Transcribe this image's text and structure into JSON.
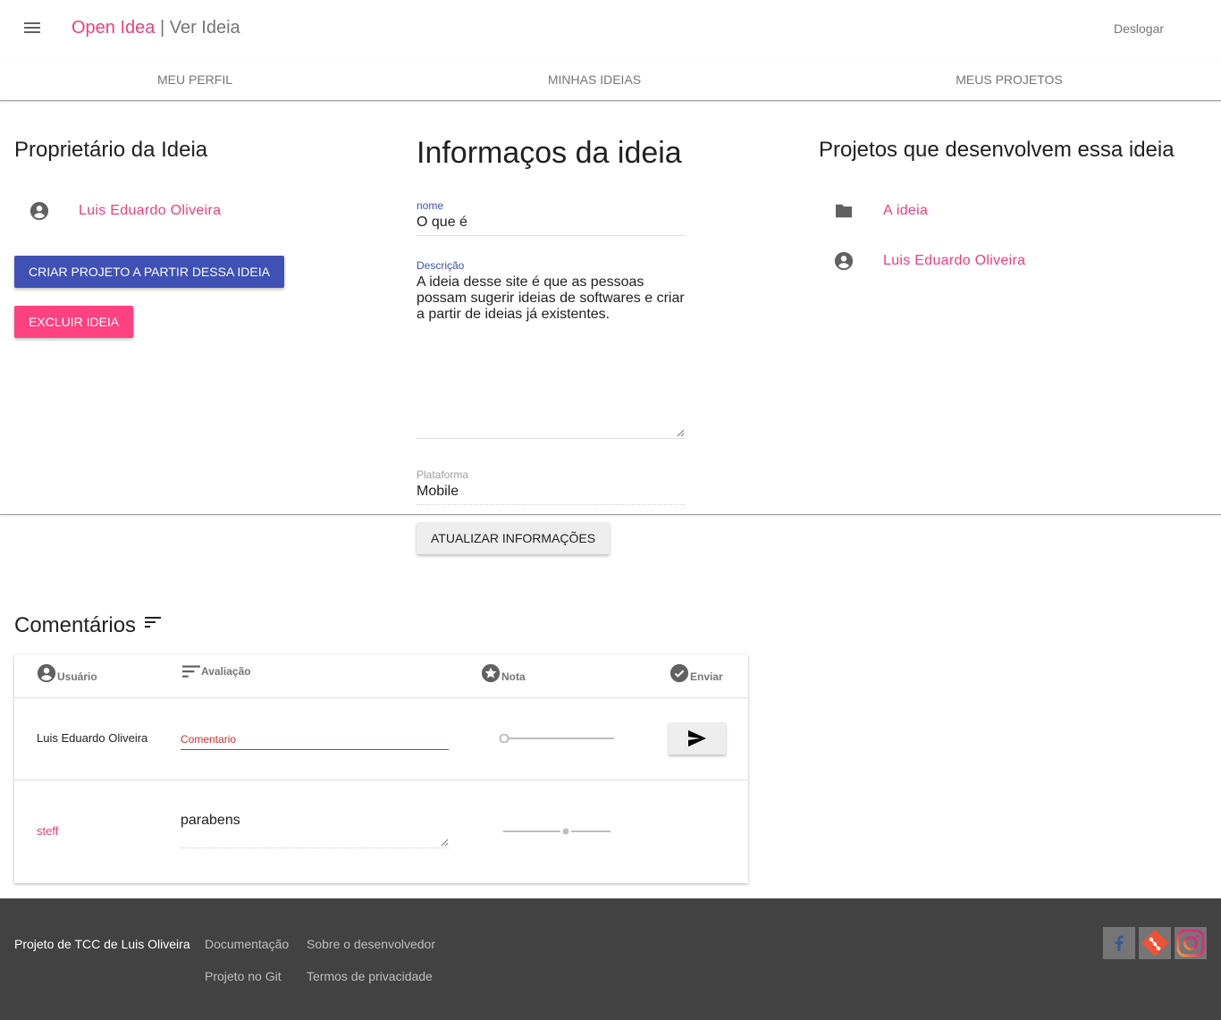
{
  "header": {
    "brand": "Open Idea",
    "separator": " | ",
    "page": "Ver Ideia",
    "logout": "Deslogar"
  },
  "tabs": [
    {
      "label": "Meu perfil"
    },
    {
      "label": "Minhas ideias"
    },
    {
      "label": "Meus projetos"
    }
  ],
  "owner": {
    "heading": "Proprietário da Ideia",
    "name": "Luis Eduardo Oliveira",
    "create_button": "Criar projeto a partir dessa ideia",
    "delete_button": "Excluir ideia"
  },
  "info": {
    "heading": "Informaços da ideia",
    "nome_label": "nome",
    "nome_value": "O que é",
    "descricao_label": "Descrição",
    "descricao_value": "A ideia desse site é que as pessoas possam sugerir ideias de softwares e criar a partir de ideias já existentes.",
    "plataforma_label": "Plataforma",
    "plataforma_value": "Mobile",
    "update_button": "Atualizar informações"
  },
  "projects": {
    "heading": "Projetos que desenvolvem essa ideia",
    "items": [
      {
        "label": "A ideia",
        "icon": "folder-icon"
      },
      {
        "label": "Luis Eduardo Oliveira",
        "icon": "account-circle-icon"
      }
    ]
  },
  "comments": {
    "heading": "Comentários",
    "columns": {
      "user": "Usuário",
      "evaluation": "Avaliação",
      "grade": "Nota",
      "send": "Enviar"
    },
    "new_row": {
      "user": "Luis Eduardo Oliveira",
      "placeholder": "Comentario",
      "grade": 0
    },
    "rows": [
      {
        "user": "steff",
        "comment": "parabens",
        "grade": 0.5
      }
    ]
  },
  "footer": {
    "owner_text": "Projeto de TCC de Luis Oliveira",
    "links": [
      "Documentação",
      "Sobre o desenvolvedor",
      "Projeto no Git",
      "Termos de privacidade"
    ],
    "social": [
      "facebook-icon",
      "git-icon",
      "instagram-icon"
    ]
  },
  "colors": {
    "accent": "#ec407a",
    "primary": "#3f51b5",
    "danger": "#ff4081",
    "footer": "#424242"
  }
}
